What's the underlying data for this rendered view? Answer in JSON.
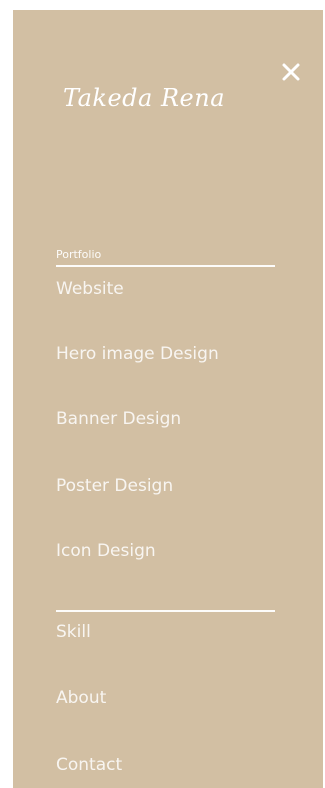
{
  "menu": {
    "logo_text": "Takeda Rena",
    "close_icon": "close-icon",
    "portfolio_label": "Portfolio",
    "portfolio_items": [
      {
        "label": "Website"
      },
      {
        "label": "Hero image Design"
      },
      {
        "label": "Banner Design"
      },
      {
        "label": "Poster Design"
      },
      {
        "label": "Icon Design"
      }
    ],
    "main_items": [
      {
        "label": "Skill"
      },
      {
        "label": "About"
      },
      {
        "label": "Contact"
      }
    ]
  },
  "colors": {
    "panel_background": "#d2bfa3",
    "text": "#ffffff"
  }
}
